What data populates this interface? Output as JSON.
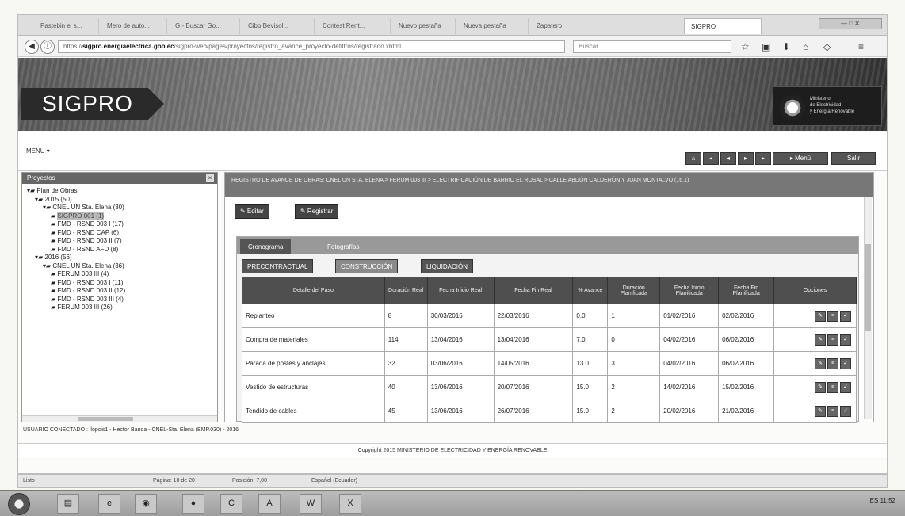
{
  "browser": {
    "tabs": [
      "Pastebin el s...",
      "Mero de auto...",
      "G - Buscar Go...",
      "Cibo Bevisol...",
      "Contest Rent...",
      "Nuevo pestaña",
      "Nueva pestaña",
      "Zapatero",
      "SIGPRO"
    ],
    "window_controls": "— □ ✕",
    "url_prefix": "https://",
    "url_domain": "sigpro.energiaelectrica.gob.ec",
    "url_path": "/sigpro-web/pages/proyectos/registro_avance_proyecto-defiltros/registrado.xhtml",
    "search_placeholder": "Buscar"
  },
  "banner": {
    "logo": "SIGPRO",
    "ministry_lines": [
      "Ministerio",
      "de Electricidad",
      "y Energía Renovable"
    ]
  },
  "menu": {
    "label": "MENU ▾",
    "right_buttons": [
      "⌂",
      "◂",
      "◂",
      "▸",
      "▸",
      "▸ Menú",
      "Salir"
    ]
  },
  "left_panel": {
    "title": "Proyectos",
    "close": "×",
    "tree": [
      {
        "indent": 0,
        "text": "Plan de Obras"
      },
      {
        "indent": 1,
        "text": "2015 (50)"
      },
      {
        "indent": 2,
        "text": "CNEL UN Sta. Elena (30)"
      },
      {
        "indent": 3,
        "text": "SIGPRO 001 (1)",
        "selected": true
      },
      {
        "indent": 3,
        "text": "FMD - RSND 003 I (17)"
      },
      {
        "indent": 3,
        "text": "FMD - RSND CAP (6)"
      },
      {
        "indent": 3,
        "text": "FMD - RSND 003 II (7)"
      },
      {
        "indent": 3,
        "text": "FMD - RSND AFD (8)"
      },
      {
        "indent": 1,
        "text": "2016 (56)"
      },
      {
        "indent": 2,
        "text": "CNEL UN Sta. Elena (36)"
      },
      {
        "indent": 3,
        "text": "FERUM 003 III (4)"
      },
      {
        "indent": 3,
        "text": "FMD - RSND 003 I (11)"
      },
      {
        "indent": 3,
        "text": "FMD - RSND 003 II (12)"
      },
      {
        "indent": 3,
        "text": "FMD - RSND 003 III (4)"
      },
      {
        "indent": 3,
        "text": "FERUM 003 III (26)"
      }
    ]
  },
  "main": {
    "breadcrumb": "REGISTRO DE AVANCE DE OBRAS: CNEL UN STA. ELENA > FERUM 003 III > ELECTRIFICACIÓN DE BARRIO EL ROSAL > CALLE ABDÓN CALDERÓN Y JUAN MONTALVO (16.1)",
    "buttons": {
      "edit": "✎ Editar",
      "register": "✎ Registrar"
    },
    "tabs1": [
      "Cronograma",
      "Fotografías"
    ],
    "tabs2": [
      "PRECONTRACTUAL",
      "CONSTRUCCIÓN",
      "LIQUIDACIÓN"
    ],
    "columns": [
      "Detalle del Paso",
      "Duración Real",
      "Fecha Inicio Real",
      "Fecha Fin Real",
      "% Avance",
      "Duración Planificada",
      "Fecha Inicio Planificada",
      "Fecha Fin Planificada",
      "Opciones"
    ],
    "rows": [
      [
        "Replanteo",
        "8",
        "30/03/2016",
        "22/03/2016",
        "0.0",
        "1",
        "01/02/2016",
        "02/02/2016"
      ],
      [
        "Compra de materiales",
        "114",
        "13/04/2016",
        "13/04/2016",
        "7.0",
        "0",
        "04/02/2016",
        "06/02/2016"
      ],
      [
        "Parada de postes y anclajes",
        "32",
        "03/06/2016",
        "14/05/2016",
        "13.0",
        "3",
        "04/02/2016",
        "06/02/2016"
      ],
      [
        "Vestido de estructuras",
        "40",
        "13/06/2016",
        "20/07/2016",
        "15.0",
        "2",
        "14/02/2016",
        "15/02/2016"
      ],
      [
        "Tendido de cables",
        "45",
        "13/06/2016",
        "26/07/2016",
        "15.0",
        "2",
        "20/02/2016",
        "21/02/2016"
      ]
    ],
    "options": [
      "✎",
      "≡",
      "✓"
    ]
  },
  "footer": {
    "user": "USUARIO CONECTADO : llopcis1 - Hector Banda - CNEL-Sta. Elena (EMP.030) - 2016",
    "copyright": "Copyright 2015 MINISTERIO DE ELECTRICIDAD Y ENERGÍA RENOVABLE"
  },
  "statusbar": {
    "left": "Listo",
    "page": "Página: 10 de 20",
    "zoom": "Posición: 7,00",
    "lang": "Español (Ecuador)"
  },
  "taskbar": {
    "items": [
      "▤",
      "e",
      "◉",
      "●",
      "C",
      "A",
      "W",
      "X"
    ],
    "clock": "ES  11:52"
  }
}
